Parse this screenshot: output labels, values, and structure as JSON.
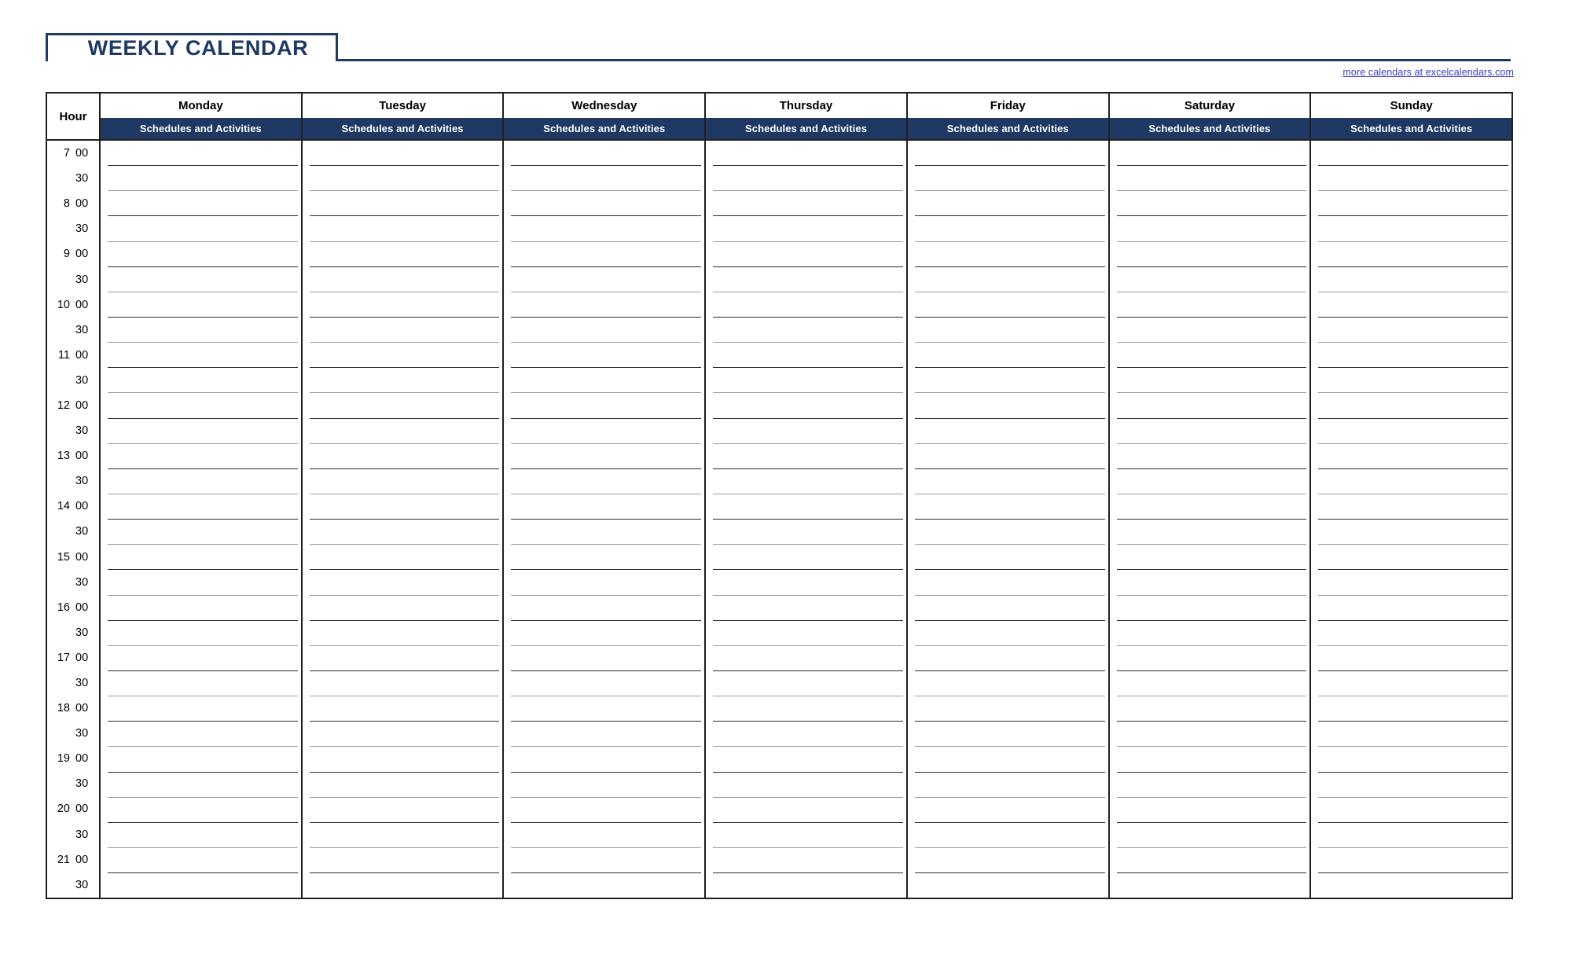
{
  "document": {
    "title": "WEEKLY CALENDAR",
    "source_link": "more calendars at excelcalendars.com"
  },
  "colors": {
    "navy": "#1F3864",
    "header_band": "#1F3864",
    "link": "#3b3bc4",
    "border": "#202020",
    "line_dark": "#2b2b2b",
    "line_light": "#9a9a9a"
  },
  "table": {
    "hour_header": "Hour",
    "day_subheader": "Schedules and Activities",
    "days": [
      {
        "name": "Monday",
        "sub": "Schedules and Activities"
      },
      {
        "name": "Tuesday",
        "sub": "Schedules and Activities"
      },
      {
        "name": "Wednesday",
        "sub": "Schedules and Activities"
      },
      {
        "name": "Thursday",
        "sub": "Schedules and Activities"
      },
      {
        "name": "Friday",
        "sub": "Schedules and Activities"
      },
      {
        "name": "Saturday",
        "sub": "Schedules and Activities"
      },
      {
        "name": "Sunday",
        "sub": "Schedules and Activities"
      }
    ],
    "time_slots": [
      {
        "hour": "7",
        "minute": "00"
      },
      {
        "hour": "",
        "minute": "30"
      },
      {
        "hour": "8",
        "minute": "00"
      },
      {
        "hour": "",
        "minute": "30"
      },
      {
        "hour": "9",
        "minute": "00"
      },
      {
        "hour": "",
        "minute": "30"
      },
      {
        "hour": "10",
        "minute": "00"
      },
      {
        "hour": "",
        "minute": "30"
      },
      {
        "hour": "11",
        "minute": "00"
      },
      {
        "hour": "",
        "minute": "30"
      },
      {
        "hour": "12",
        "minute": "00"
      },
      {
        "hour": "",
        "minute": "30"
      },
      {
        "hour": "13",
        "minute": "00"
      },
      {
        "hour": "",
        "minute": "30"
      },
      {
        "hour": "14",
        "minute": "00"
      },
      {
        "hour": "",
        "minute": "30"
      },
      {
        "hour": "15",
        "minute": "00"
      },
      {
        "hour": "",
        "minute": "30"
      },
      {
        "hour": "16",
        "minute": "00"
      },
      {
        "hour": "",
        "minute": "30"
      },
      {
        "hour": "17",
        "minute": "00"
      },
      {
        "hour": "",
        "minute": "30"
      },
      {
        "hour": "18",
        "minute": "00"
      },
      {
        "hour": "",
        "minute": "30"
      },
      {
        "hour": "19",
        "minute": "00"
      },
      {
        "hour": "",
        "minute": "30"
      },
      {
        "hour": "20",
        "minute": "00"
      },
      {
        "hour": "",
        "minute": "30"
      },
      {
        "hour": "21",
        "minute": "00"
      },
      {
        "hour": "",
        "minute": "30"
      }
    ]
  }
}
